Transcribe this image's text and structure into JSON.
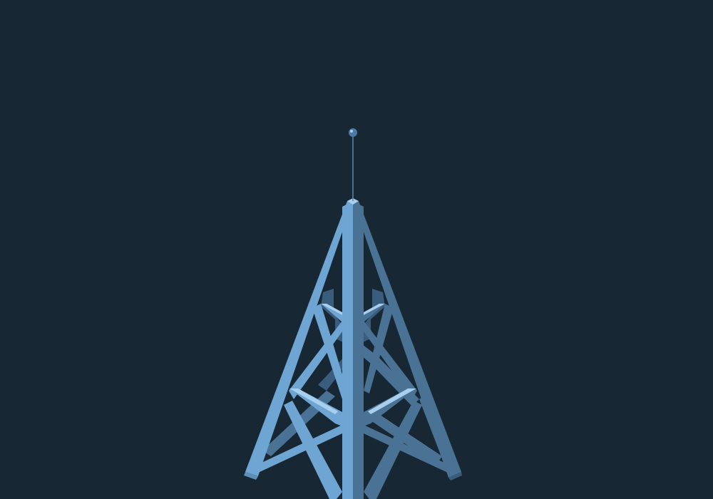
{
  "scene": {
    "subject": "radio-tower-icon",
    "background_color": "#172834",
    "colors": {
      "light": "#6fa5d3",
      "medium": "#5d8fb8",
      "dark": "#4a7295",
      "darker": "#3a5d7d",
      "highlight": "#a9cfee",
      "mast_line": "#5b88b0",
      "ball": "#4d7ba5"
    }
  }
}
